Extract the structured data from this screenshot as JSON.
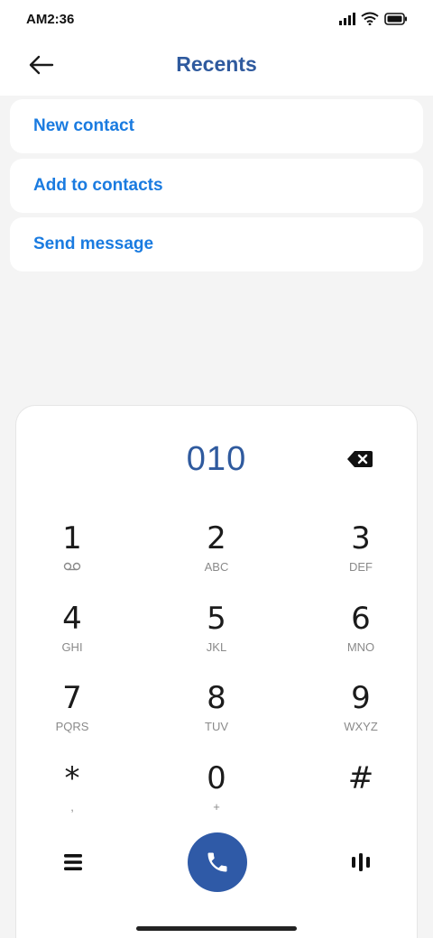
{
  "status_bar": {
    "time": "AM2:36",
    "icons": [
      "signal-icon",
      "wifi-icon",
      "battery-icon"
    ]
  },
  "header": {
    "title": "Recents",
    "back_icon": "back-arrow-icon"
  },
  "options": {
    "new_contact": "New contact",
    "add_to_contacts": "Add to contacts",
    "send_message": "Send message"
  },
  "dialpad": {
    "number": "010",
    "backspace_icon": "backspace-icon",
    "keys": [
      {
        "digit": "1",
        "letters": ""
      },
      {
        "digit": "2",
        "letters": "ABC"
      },
      {
        "digit": "3",
        "letters": "DEF"
      },
      {
        "digit": "4",
        "letters": "GHI"
      },
      {
        "digit": "5",
        "letters": "JKL"
      },
      {
        "digit": "6",
        "letters": "MNO"
      },
      {
        "digit": "7",
        "letters": "PQRS"
      },
      {
        "digit": "8",
        "letters": "TUV"
      },
      {
        "digit": "9",
        "letters": "WXYZ"
      },
      {
        "digit": "*",
        "letters": ","
      },
      {
        "digit": "0",
        "letters": "+"
      },
      {
        "digit": "#",
        "letters": ""
      }
    ],
    "voicemail_icon": "voicemail-icon",
    "menu_icon": "menu-icon",
    "call_icon": "phone-icon",
    "t9_icon": "t9-keyboard-icon"
  },
  "colors": {
    "accent_blue": "#2f5a9e",
    "link_blue": "#1a7be0",
    "call_button": "#2f5aa7",
    "background": "#f4f4f4"
  }
}
